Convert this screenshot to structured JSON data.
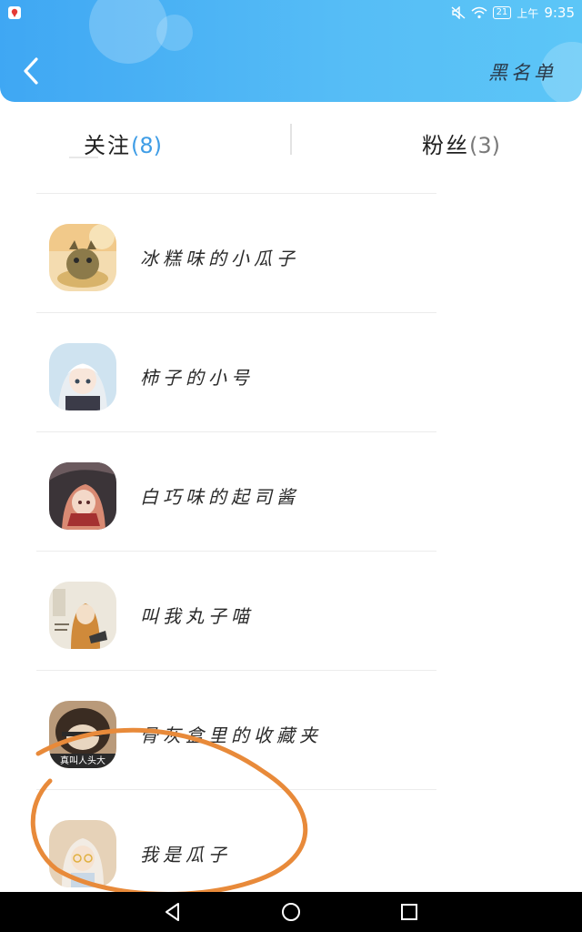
{
  "status_bar": {
    "time": "9:35",
    "battery": "21",
    "period": "上午"
  },
  "header": {
    "blacklist_label": "黑名单"
  },
  "tabs": {
    "following": {
      "label": "关注",
      "count": "(8)"
    },
    "fans": {
      "label": "粉丝",
      "count": "(3)"
    }
  },
  "list": {
    "items": [
      {
        "name": "冰糕味的小瓜子"
      },
      {
        "name": "柿子的小号"
      },
      {
        "name": "白巧味的起司酱"
      },
      {
        "name": "叫我丸子喵"
      },
      {
        "name": "骨灰盒里的收藏夹",
        "avatar_caption": "真叫人头大"
      },
      {
        "name": "我是瓜子"
      }
    ]
  },
  "colors": {
    "header_start": "#3fa7f3",
    "header_end": "#5cc6f7",
    "accent": "#3f9de6",
    "annotation": "#e88a3a"
  }
}
